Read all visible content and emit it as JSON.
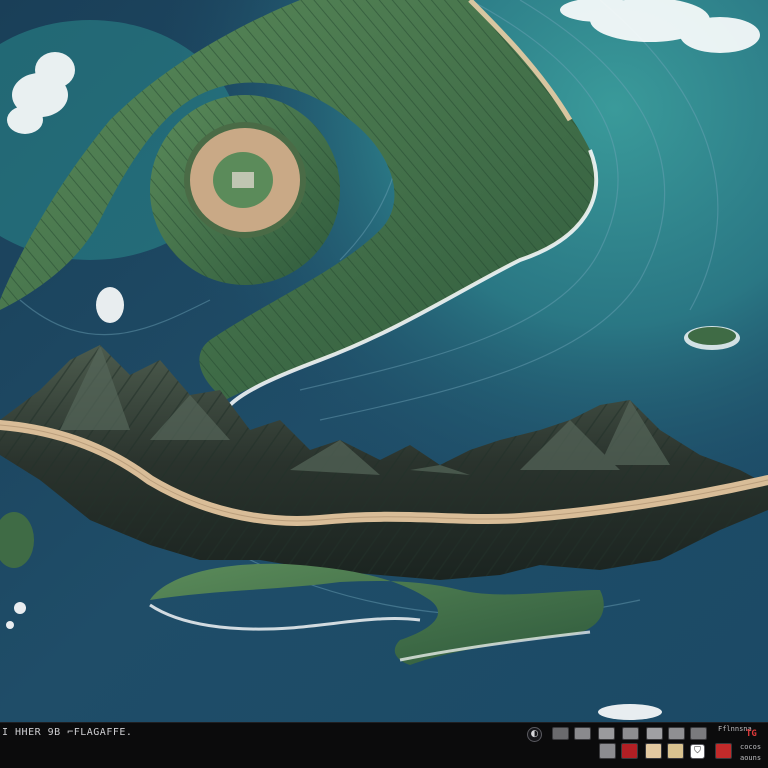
{
  "colors": {
    "ocean": "#1d4c67",
    "lagoon": "#2c8a8a",
    "forest": "#3f6b45",
    "ridge": "#2c3a32",
    "sand": "#c9ab84",
    "surf": "#ffffff",
    "bar": "#0b0b0c"
  },
  "info_bar": {
    "text_line1": "I HHER 9B ⌐FLAGAFFE.",
    "text_line2": "",
    "text_line3": "",
    "right_label_top": "Fflnnsna",
    "right_label_red": "TG",
    "right_label_a": "cocos",
    "right_label_b": "aouns"
  },
  "toolbar": {
    "icons": [
      "circle-toggle-icon",
      "shield-icon",
      "bookmark-icon"
    ],
    "swatches_top": [
      "#6a6a6d",
      "#8a8a8d",
      "#9a9a9d",
      "#8d8d90",
      "#a0a0a3"
    ],
    "swatches_bottom": [
      "#8c8c90",
      "#b21f24",
      "#e3c9a0",
      "#d9c28f",
      "#ffffff"
    ]
  }
}
